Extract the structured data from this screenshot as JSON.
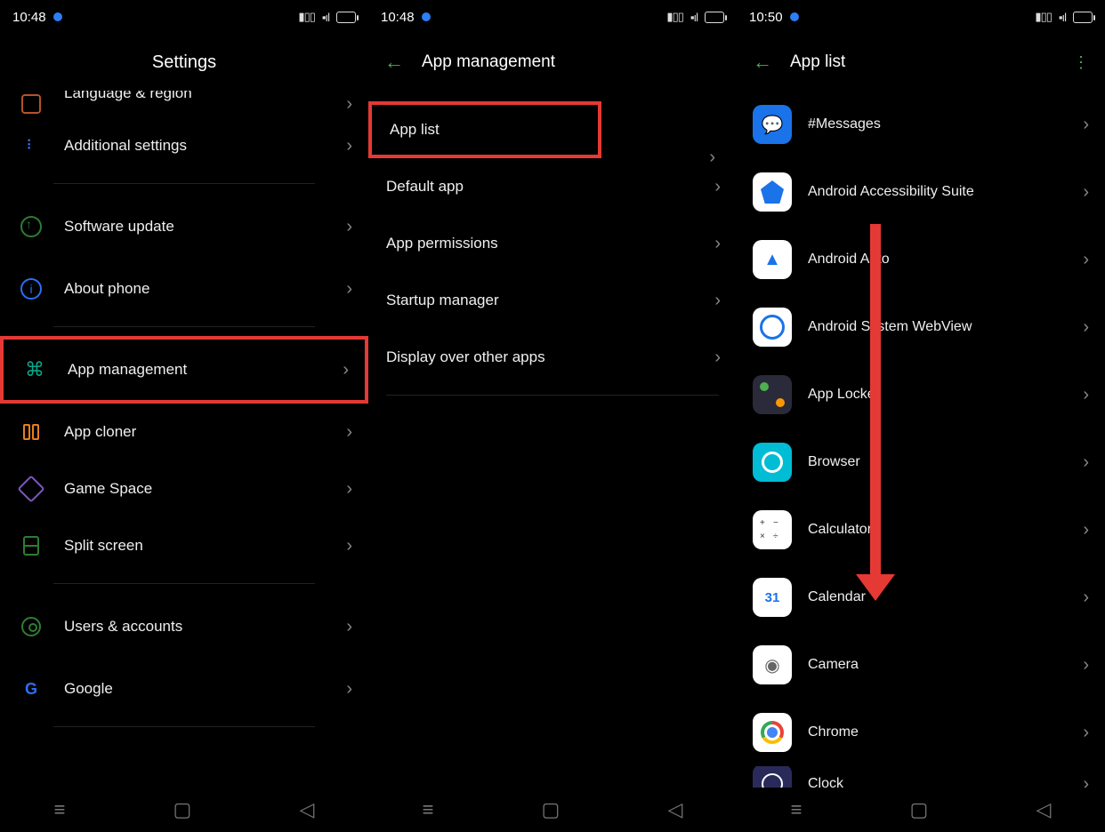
{
  "screen1": {
    "status": {
      "time": "10:48"
    },
    "title": "Settings",
    "items": [
      {
        "label": "Language & region",
        "icon": "language-icon",
        "highlight": false,
        "cutoff": true
      },
      {
        "label": "Additional settings",
        "icon": "additional-settings-icon",
        "highlight": false
      },
      {
        "divider": true
      },
      {
        "label": "Software update",
        "icon": "software-update-icon",
        "highlight": false
      },
      {
        "label": "About phone",
        "icon": "about-phone-icon",
        "highlight": false
      },
      {
        "divider": true
      },
      {
        "label": "App management",
        "icon": "app-management-icon",
        "highlight": true
      },
      {
        "label": "App cloner",
        "icon": "app-cloner-icon",
        "highlight": false
      },
      {
        "label": "Game Space",
        "icon": "game-space-icon",
        "highlight": false
      },
      {
        "label": "Split screen",
        "icon": "split-screen-icon",
        "highlight": false
      },
      {
        "divider": true
      },
      {
        "label": "Users & accounts",
        "icon": "users-accounts-icon",
        "highlight": false
      },
      {
        "label": "Google",
        "icon": "google-icon",
        "highlight": false
      },
      {
        "divider": true
      }
    ]
  },
  "screen2": {
    "status": {
      "time": "10:48"
    },
    "title": "App management",
    "items": [
      {
        "label": "App list",
        "highlight": true
      },
      {
        "label": "Default app",
        "highlight": false
      },
      {
        "label": "App permissions",
        "highlight": false
      },
      {
        "label": "Startup manager",
        "highlight": false
      },
      {
        "label": "Display over other apps",
        "highlight": false
      },
      {
        "divider": true
      }
    ]
  },
  "screen3": {
    "status": {
      "time": "10:50"
    },
    "title": "App list",
    "apps": [
      {
        "label": "#Messages",
        "icon": "messages-app-icon"
      },
      {
        "label": "Android Accessibility Suite",
        "icon": "accessibility-app-icon"
      },
      {
        "label": "Android Auto",
        "icon": "android-auto-app-icon"
      },
      {
        "label": "Android System WebView",
        "icon": "webview-app-icon"
      },
      {
        "label": "App Locker",
        "icon": "app-locker-app-icon"
      },
      {
        "label": "Browser",
        "icon": "browser-app-icon"
      },
      {
        "label": "Calculator",
        "icon": "calculator-app-icon"
      },
      {
        "label": "Calendar",
        "icon": "calendar-app-icon"
      },
      {
        "label": "Camera",
        "icon": "camera-app-icon"
      },
      {
        "label": "Chrome",
        "icon": "chrome-app-icon"
      },
      {
        "label": "Clock",
        "icon": "clock-app-icon"
      }
    ]
  }
}
